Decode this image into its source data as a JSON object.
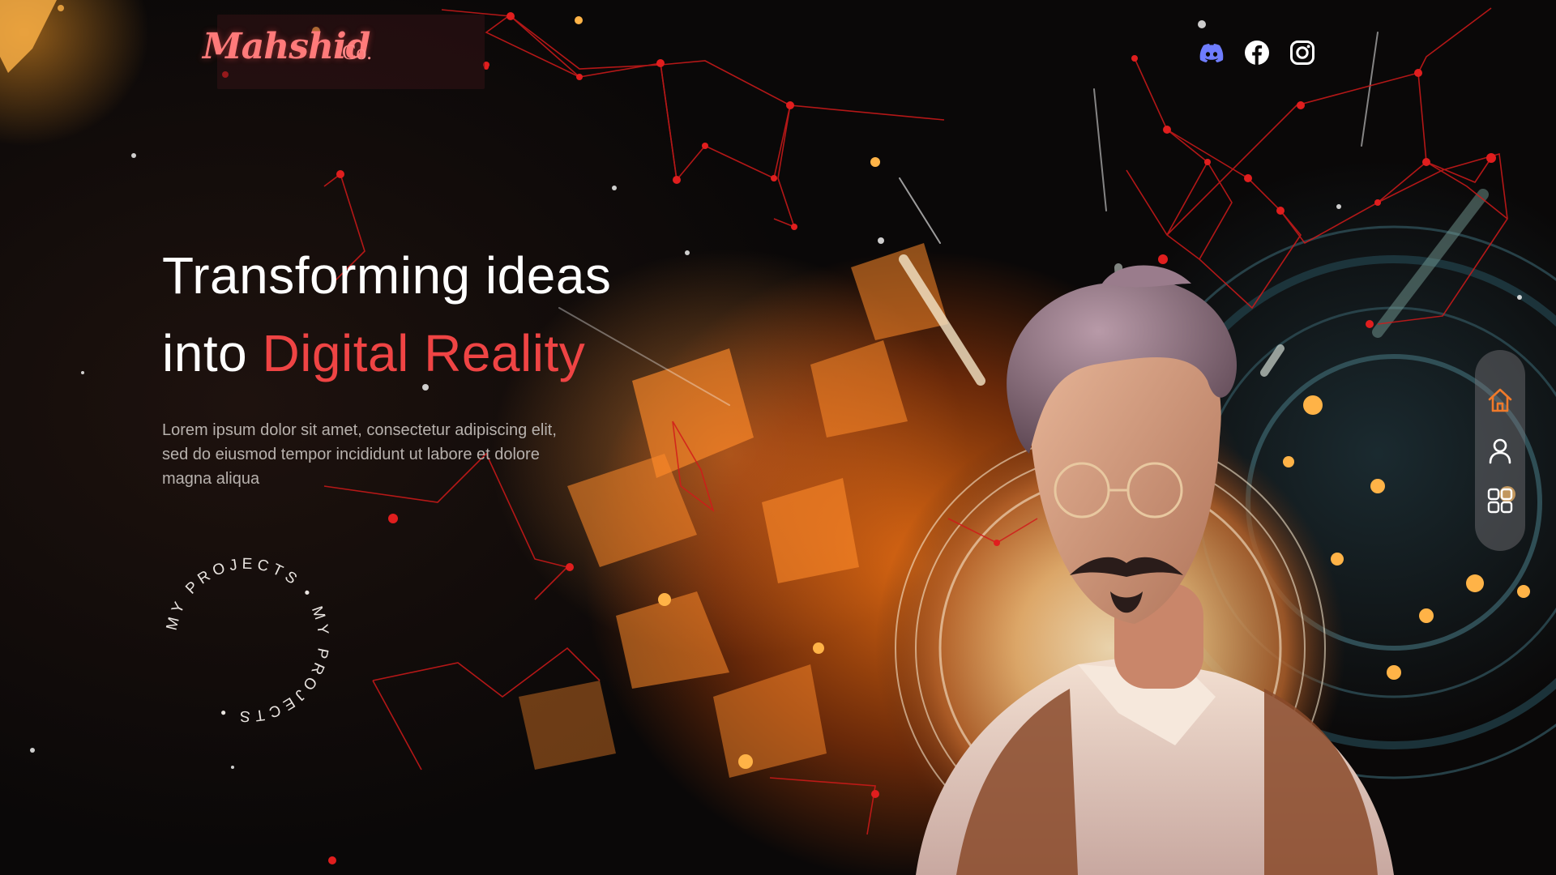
{
  "brand": {
    "script": "Mahshid",
    "suffix": "Co."
  },
  "social": [
    {
      "name": "Discord",
      "icon": "discord-icon",
      "color": "#6f7dff"
    },
    {
      "name": "Facebook",
      "icon": "facebook-icon",
      "color": "#ffffff"
    },
    {
      "name": "Instagram",
      "icon": "instagram-icon",
      "color": "#ffffff"
    }
  ],
  "hero": {
    "headline_line1": "Transforming ideas",
    "headline_line2_prefix": "into ",
    "headline_line2_accent": "Digital Reality",
    "lead": "Lorem ipsum dolor sit amet, consectetur adipiscing elit, sed do eiusmod tempor incididunt ut labore et dolore magna aliqua"
  },
  "badge": {
    "text": "MY PROJECTS • MY PROJECTS •"
  },
  "side_nav": [
    {
      "name": "home",
      "icon": "home-icon",
      "active": true
    },
    {
      "name": "profile",
      "icon": "user-icon",
      "active": false
    },
    {
      "name": "projects",
      "icon": "grid-icon",
      "active": false
    }
  ],
  "colors": {
    "accent": "#ef4444",
    "nav_active": "#f07a2a",
    "text_muted": "#b7b1ad"
  }
}
